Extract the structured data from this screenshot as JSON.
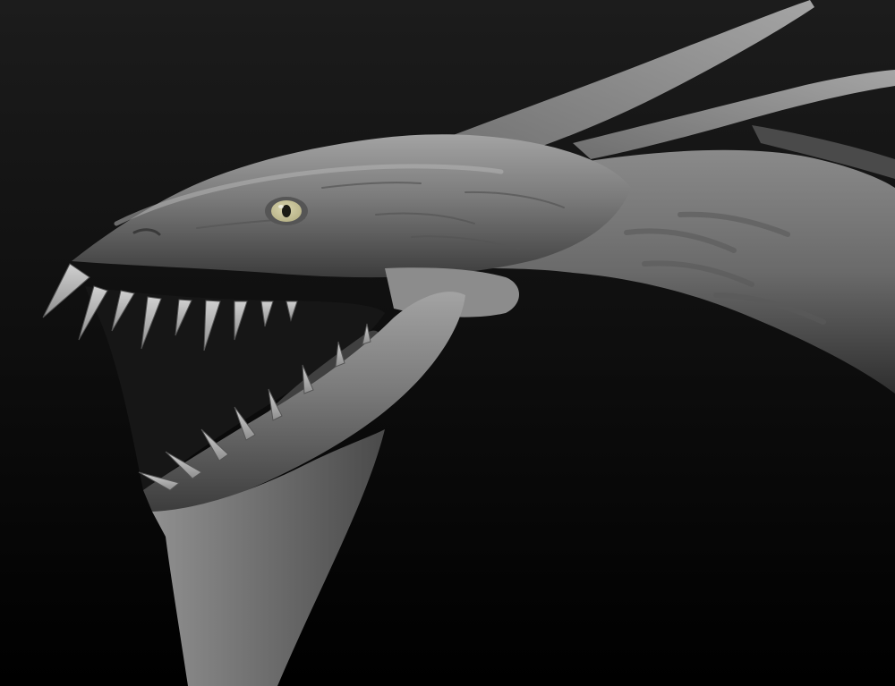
{
  "scene": {
    "subject": "dragon-head-sculpt",
    "palette": {
      "background_top": "#1c1c1c",
      "background_bottom": "#000000",
      "skin_light": "#a3a3a3",
      "skin_mid": "#7a7a7a",
      "skin_dark": "#3c3c3c",
      "mouth_interior": "#161616",
      "tooth": "#b8b8b8",
      "eye_iris": "#b9b489",
      "eye_pupil": "#1b1b14"
    }
  }
}
